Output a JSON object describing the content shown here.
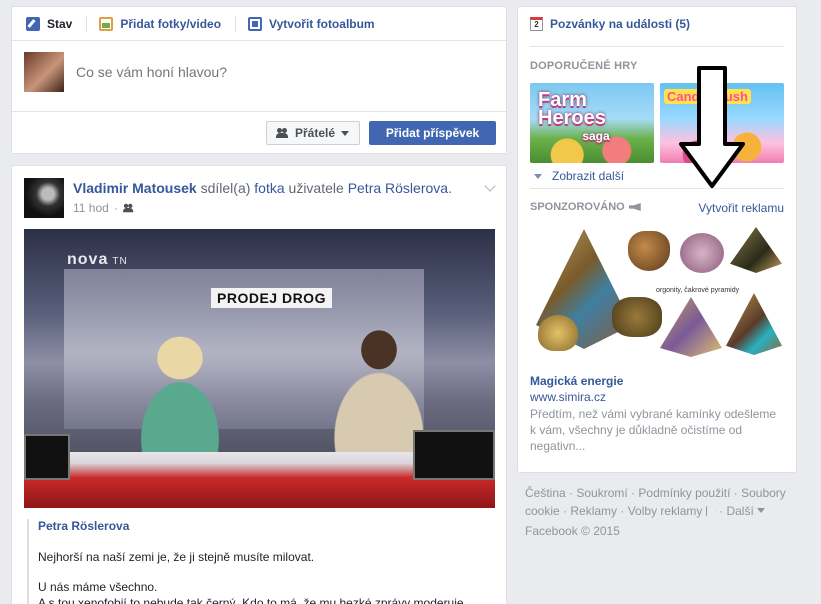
{
  "composer": {
    "tabs": [
      {
        "label": "Stav",
        "icon": "pencil-icon"
      },
      {
        "label": "Přidat fotky/video",
        "icon": "photo-icon"
      },
      {
        "label": "Vytvořit fotoalbum",
        "icon": "album-icon"
      }
    ],
    "placeholder": "Co se vám honí hlavou?",
    "audience_label": "Přátelé",
    "post_label": "Přidat příspěvek"
  },
  "post": {
    "author": "Vladimir Matousek",
    "action_pre": "sdílel(a)",
    "action_link": "fotka",
    "action_mid": "uživatele",
    "shared_user": "Petra Röslerova",
    "shared_suffix": ".",
    "time": "11 hod",
    "image": {
      "channel_logo": "nova",
      "channel_suffix": "TN",
      "sign_text": "PRODEJ DROG"
    },
    "quote_author": "Petra Röslerova",
    "quote_paragraphs": [
      "Nejhorší na naší zemi je, že ji stejně musíte milovat.",
      "U nás máme všechno.\nA s tou xenofobií to nebude tak černý. Kdo to má, že mu hezké zprávy moderuje"
    ]
  },
  "sidebar": {
    "events_label": "Pozvánky na události (5)",
    "events_icon_text": "2",
    "games_heading": "DOPORUČENÉ HRY",
    "games": [
      {
        "title": "Farm Heroes",
        "subtitle": "saga"
      },
      {
        "title": "Candy Crush"
      }
    ],
    "show_more": "Zobrazit další",
    "sponsored_heading": "SPONZOROVÁNO",
    "create_ad": "Vytvořit reklamu",
    "ad": {
      "image_caption": "orgonity, čakrové pyramidy",
      "title": "Magická energie",
      "url": "www.simira.cz",
      "description": "Předtím, než vámi vybrané kamínky odešleme k vám, všechny je důkladně očistíme od negativn..."
    }
  },
  "footer": {
    "links": [
      "Čeština",
      "Soukromí",
      "Podmínky použití",
      "Soubory cookie",
      "Reklamy",
      "Volby reklamy",
      "Další"
    ],
    "copyright": "Facebook © 2015"
  },
  "colors": {
    "brand": "#4267b2",
    "link": "#365899",
    "muted": "#90949c",
    "page_bg": "#e9ebee"
  }
}
